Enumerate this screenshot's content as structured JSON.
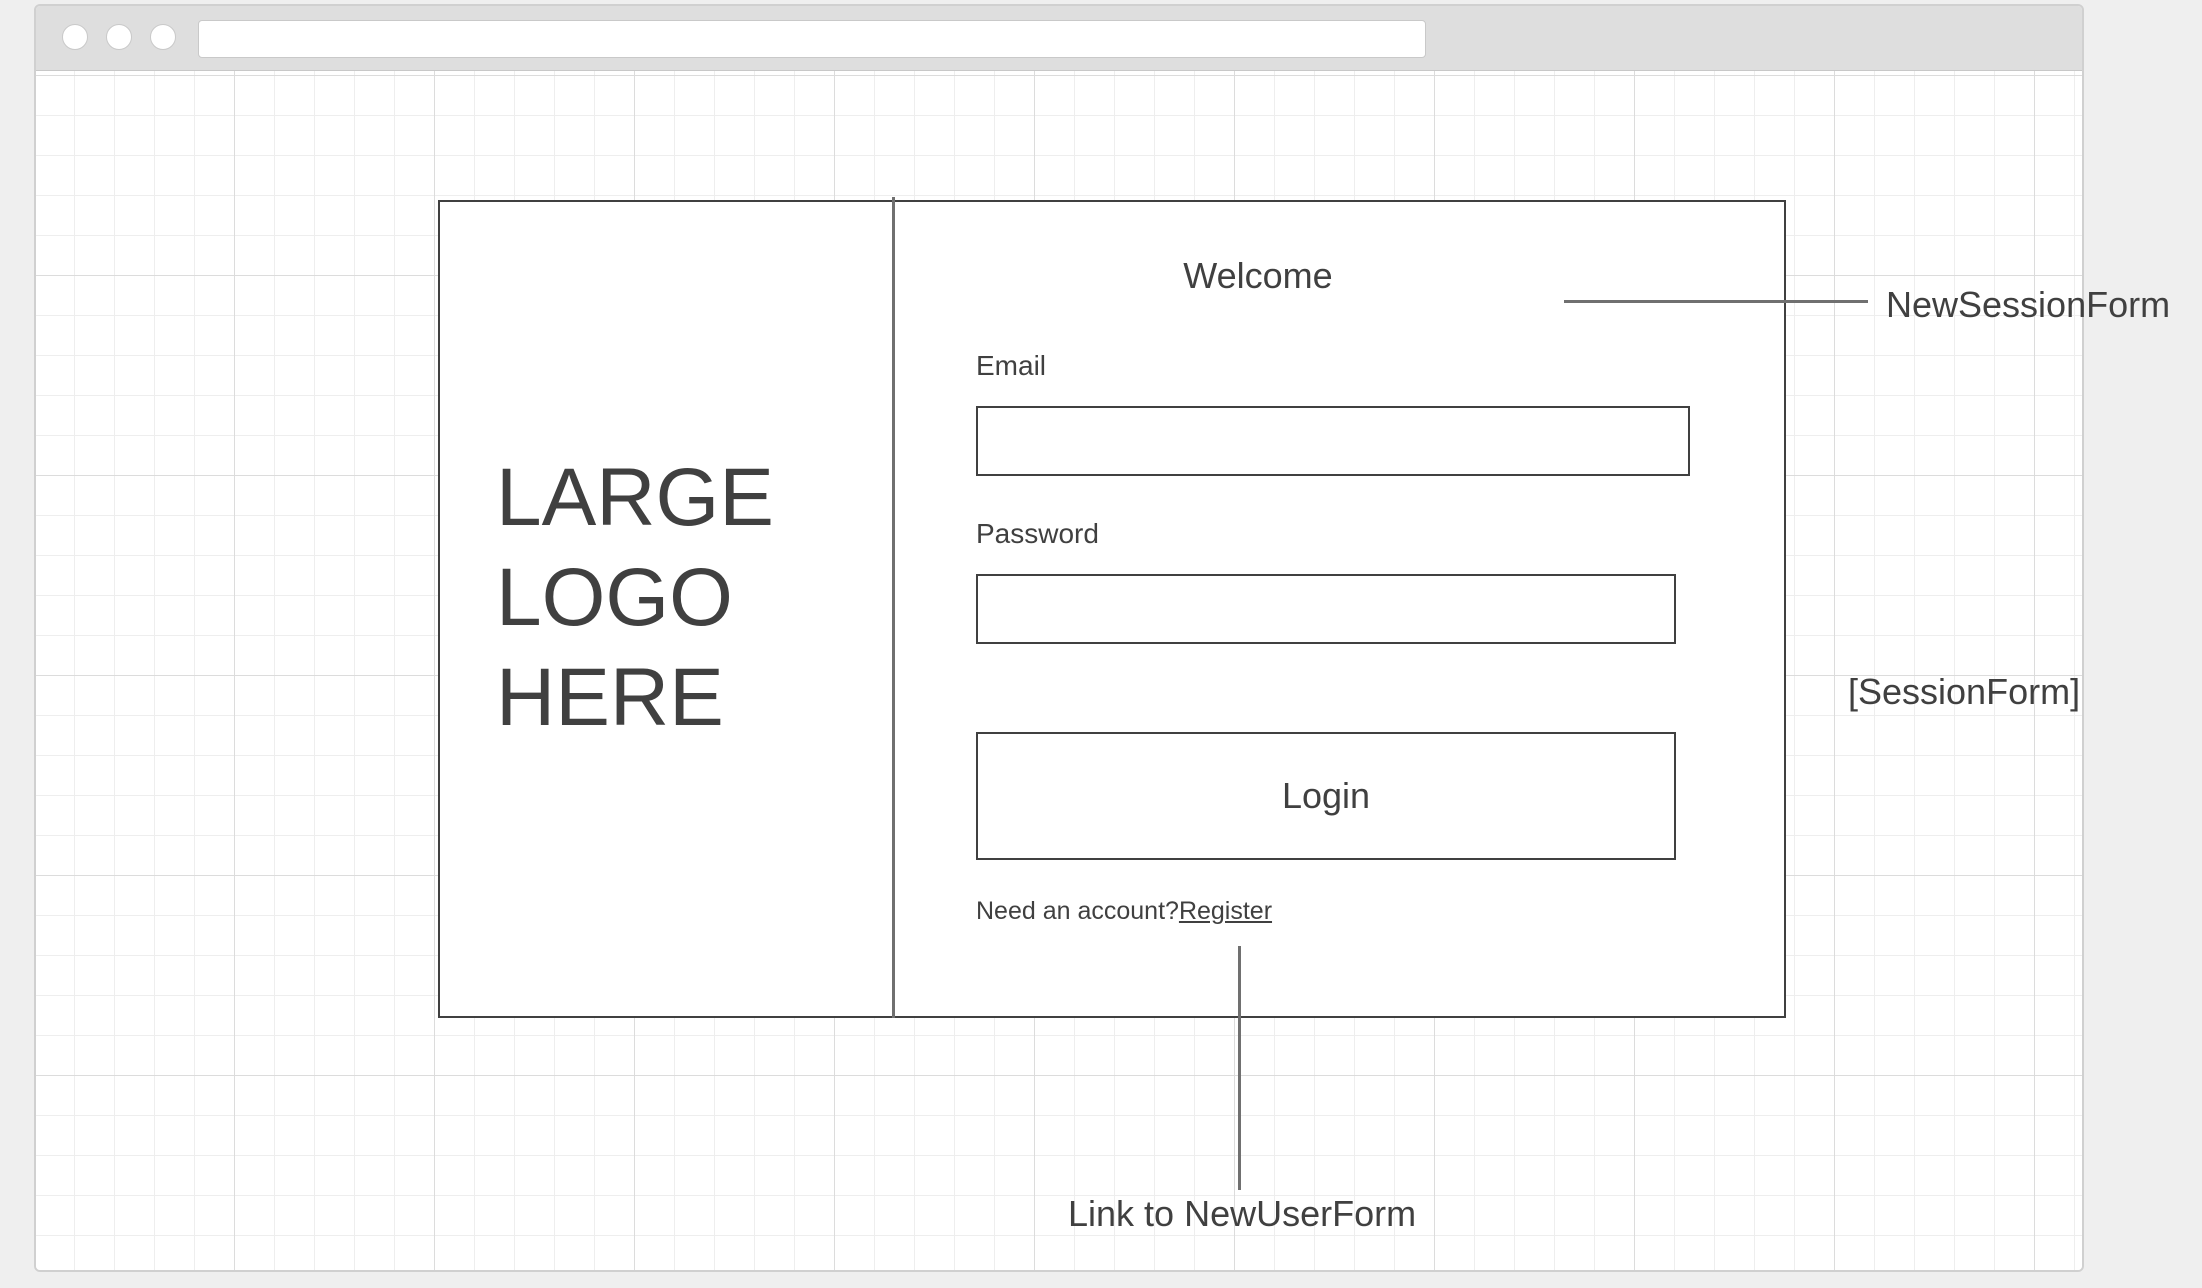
{
  "logo": {
    "lines": [
      "LARGE",
      "LOGO",
      "HERE"
    ]
  },
  "form": {
    "title": "Welcome",
    "email_label": "Email",
    "email_value": "",
    "password_label": "Password",
    "password_value": "",
    "login_label": "Login",
    "need_account_text": "Need an account?",
    "register_link": "Register"
  },
  "annotations": {
    "new_session_form": "NewSessionForm",
    "session_form": "[SessionForm]",
    "link_note": "Link to NewUserForm"
  }
}
